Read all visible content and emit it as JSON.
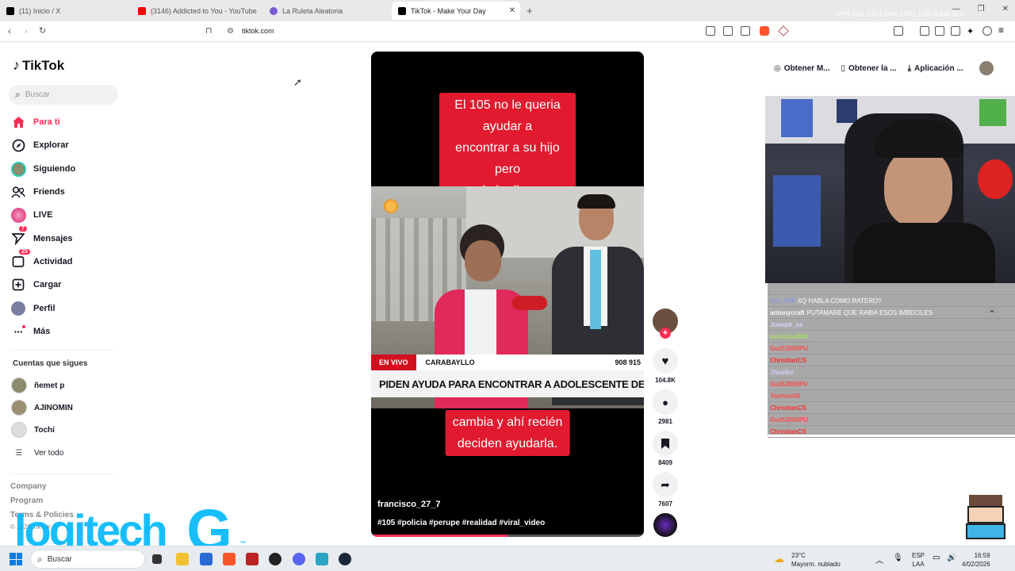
{
  "browser": {
    "tabs": [
      {
        "title": "(11) Inicio / X",
        "favicon_color": "#000000"
      },
      {
        "title": "(3146) Addicted to You - YouTube",
        "favicon_color": "#ff0000"
      },
      {
        "title": "La Ruleta Aleatoria",
        "favicon_color": "#7b5cd6"
      },
      {
        "title": "TikTok - Make Your Day",
        "favicon_color": "#000000",
        "active": true
      }
    ],
    "url": "tiktok.com",
    "overlay_stats": "FPS N/A    GPU 24%    CPU 13%    RAM N/A"
  },
  "tiktok": {
    "logo_text": "TikTok",
    "search_placeholder": "Buscar",
    "nav": [
      {
        "label": "Para ti",
        "icon": "home-icon",
        "active": true
      },
      {
        "label": "Explorar",
        "icon": "compass-icon"
      },
      {
        "label": "Siguiendo",
        "icon": "following-avatar-icon"
      },
      {
        "label": "Friends",
        "icon": "friends-icon"
      },
      {
        "label": "LIVE",
        "icon": "live-icon"
      },
      {
        "label": "Mensajes",
        "icon": "messages-icon",
        "badge": "7"
      },
      {
        "label": "Actividad",
        "icon": "activity-icon",
        "badge": "25"
      },
      {
        "label": "Cargar",
        "icon": "upload-icon"
      },
      {
        "label": "Perfil",
        "icon": "profile-icon"
      },
      {
        "label": "Más",
        "icon": "more-icon"
      }
    ],
    "following_title": "Cuentas que sigues",
    "following": [
      {
        "name": "ñemet p"
      },
      {
        "name": "AJINOMIN"
      },
      {
        "name": "Tochi"
      }
    ],
    "see_all": "Ver todo",
    "footer": [
      "Company",
      "Program",
      "Terms & Policies",
      "© 2026 TikTok"
    ],
    "header_buttons": [
      "Obtener M...",
      "Obtener la ...",
      "Aplicación ..."
    ]
  },
  "video": {
    "caption_top": "El 105 no le queria ayudar a\nencontrar a su hijo pero\ncuando le dicen que está\nen vivo en televisión.",
    "caption_bottom": "cambia y ahí recién\ndeciden ayudarla.",
    "ticker_live": "EN VIVO",
    "ticker_place": "CARABAYLLO",
    "ticker_phone": "908 915",
    "ticker_headline": "PIDEN AYUDA PARA ENCONTRAR A ADOLESCENTE DESAPARECIDO EN",
    "author": "francisco_27_7",
    "hashtags": "#105 #policia #perupe #realidad #viral_video",
    "progress": 0.5,
    "likes": "104.8K",
    "comments": "2981",
    "saves": "8409",
    "shares": "7607"
  },
  "chat": [
    {
      "user": "",
      "msg": "",
      "color": "#9b59d0"
    },
    {
      "user": "lucl_596",
      "msg": "XQ HABLA COMO RATERO?",
      "color": "#8e9bd6"
    },
    {
      "user": "antonycraft",
      "msg": "PUTAMARE QUE RABIA ESOS IMBECILES",
      "color": "#f7f7f7"
    },
    {
      "user": "Joseph_ss",
      "msg": "",
      "color": "#d4d4ff"
    },
    {
      "user": "moris2xd842",
      "msg": "",
      "color": "#a6e060"
    },
    {
      "user": "GutS2005PU",
      "msg": "",
      "color": "#ff4a4a"
    },
    {
      "user": "ChristianCS",
      "msg": "",
      "color": "#ff2d2d"
    },
    {
      "user": "Jhoelks",
      "msg": "",
      "color": "#cfcfff"
    },
    {
      "user": "GutS2005PU",
      "msg": "",
      "color": "#ff4a4a"
    },
    {
      "user": "Yochiro00",
      "msg": "",
      "color": "#ff4a4a"
    },
    {
      "user": "ChristianCS",
      "msg": "",
      "color": "#ff2d2d"
    },
    {
      "user": "GutS2005PU",
      "msg": "",
      "color": "#ff4a4a"
    },
    {
      "user": "ChristianCS",
      "msg": "",
      "color": "#ff2d2d"
    }
  ],
  "watermark": "logitech",
  "taskbar": {
    "search_placeholder": "Buscar",
    "weather_temp": "23°C",
    "weather_desc": "Mayorm. nublado",
    "lang_line1": "ESP",
    "lang_line2": "LAA",
    "time": "16:59",
    "date": "4/02/2026"
  },
  "colors": {
    "accent": "#fe2c55",
    "caption_red": "#e11a2f",
    "logitech_blue": "#00b8fc"
  }
}
